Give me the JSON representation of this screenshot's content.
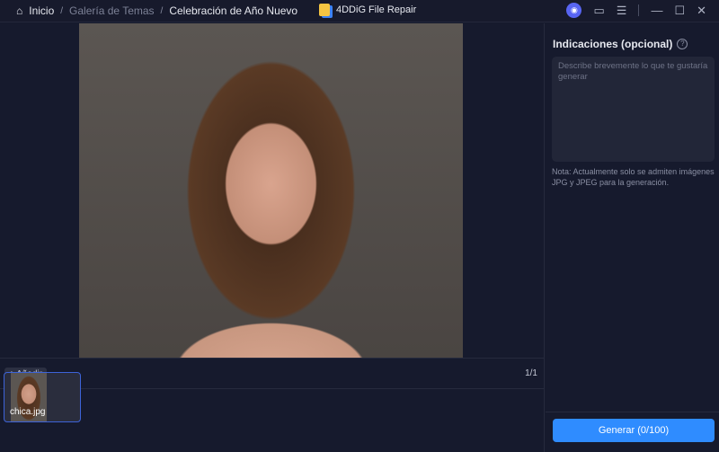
{
  "breadcrumb": {
    "home": "Inicio",
    "gallery": "Galería de Temas",
    "current": "Celebración de Año Nuevo"
  },
  "app_title": "4DDiG File Repair",
  "toolbar": {
    "add_label": "+ Añadir",
    "page_count": "1/1"
  },
  "thumbnails": [
    {
      "name": "chica.jpg"
    }
  ],
  "panel": {
    "title": "Indicaciones (opcional)",
    "help": "?",
    "placeholder": "Describe brevemente lo que te gustaría generar",
    "note": "Nota: Actualmente solo se admiten imágenes JPG y JPEG para la generación.",
    "generate_label": "Generar (0/100)"
  },
  "colors": {
    "accent": "#2f8cff",
    "background": "#161a2d"
  }
}
